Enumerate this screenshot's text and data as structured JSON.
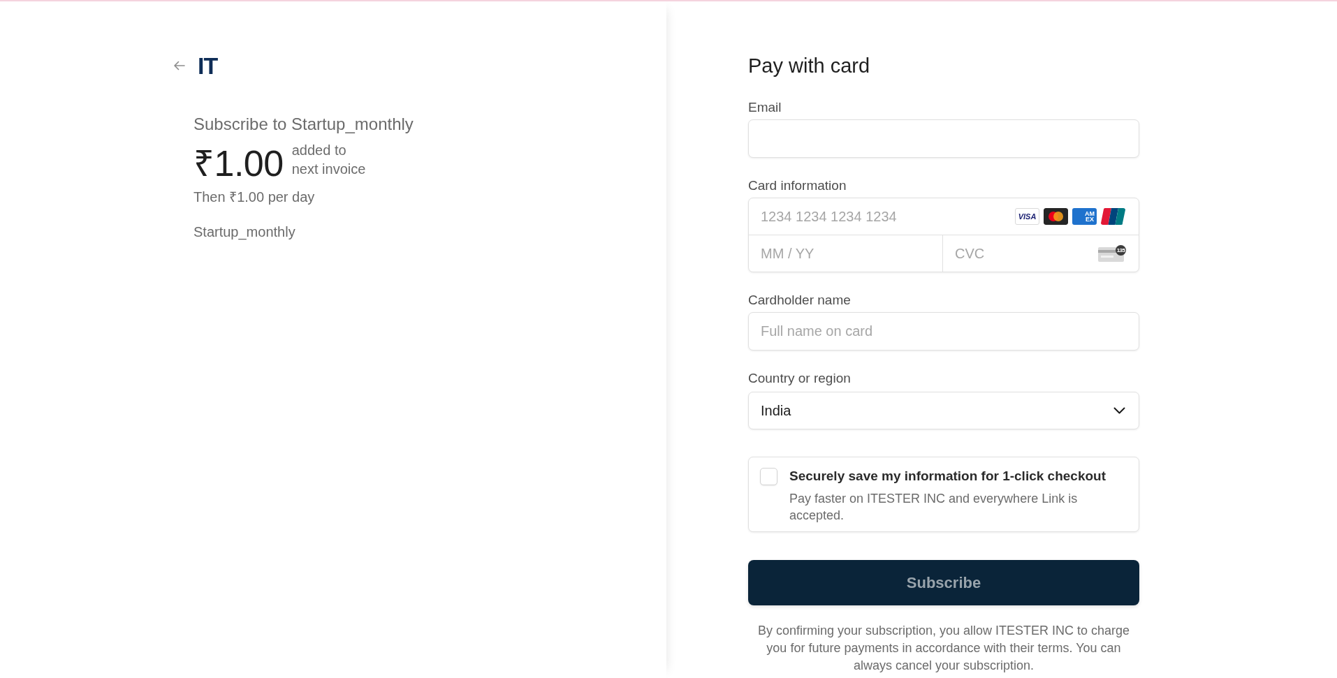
{
  "header": {
    "logo": "IT"
  },
  "summary": {
    "title": "Subscribe to Startup_monthly",
    "amount": "₹1.00",
    "amount_note": "added to next invoice",
    "recurring": "Then ₹1.00 per day",
    "product": "Startup_monthly"
  },
  "payment": {
    "title": "Pay with card",
    "email": {
      "label": "Email"
    },
    "card": {
      "label": "Card information",
      "number_placeholder": "1234 1234 1234 1234",
      "brands": [
        {
          "kind": "visa",
          "text": "VISA"
        },
        {
          "kind": "mastercard"
        },
        {
          "kind": "amex",
          "text": "AM EX"
        },
        {
          "kind": "unionpay"
        }
      ],
      "expiry_placeholder": "MM / YY",
      "cvc_placeholder": "CVC",
      "cvc_hint": "135"
    },
    "cardholder": {
      "label": "Cardholder name",
      "placeholder": "Full name on card"
    },
    "country": {
      "label": "Country or region",
      "value": "India"
    },
    "save_info": {
      "checked": false,
      "title": "Securely save my information for 1-click checkout",
      "description": "Pay faster on ITESTER INC and everywhere Link is accepted."
    },
    "submit": {
      "label": "Subscribe",
      "disabled": true
    },
    "terms": "By confirming your subscription, you allow ITESTER INC to charge you for future payments in accordance with their terms. You can always cancel your subscription."
  }
}
